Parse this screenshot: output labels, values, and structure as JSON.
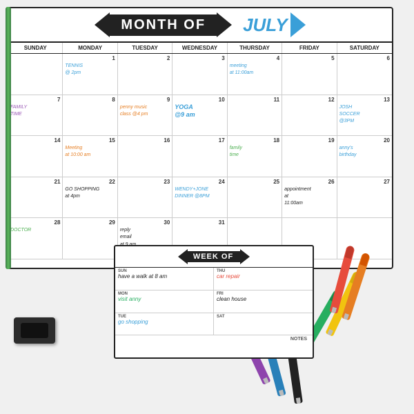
{
  "header": {
    "month_of_label": "MONTH OF",
    "month_name": "JULY"
  },
  "day_headers": [
    "SUNDAY",
    "MONDAY",
    "TUESDAY",
    "WEDNESDAY",
    "THURSDAY",
    "FRIDAY",
    "SATURDAY"
  ],
  "calendar": {
    "weeks": [
      [
        {
          "num": "",
          "events": []
        },
        {
          "num": "1",
          "events": [
            {
              "text": "TENNIS @ 2pm",
              "color": "blue"
            }
          ]
        },
        {
          "num": "2",
          "events": []
        },
        {
          "num": "3",
          "events": []
        },
        {
          "num": "4",
          "events": [
            {
              "text": "meeting at 11:00am",
              "color": "blue"
            }
          ]
        },
        {
          "num": "5",
          "events": []
        },
        {
          "num": "6",
          "events": []
        }
      ],
      [
        {
          "num": "7",
          "events": [
            {
              "text": "FAMILY TIME",
              "color": "purple"
            }
          ]
        },
        {
          "num": "8",
          "events": []
        },
        {
          "num": "9",
          "events": [
            {
              "text": "penny music class @4 pm",
              "color": "orange"
            }
          ]
        },
        {
          "num": "10",
          "events": [
            {
              "text": "YOGA @9 am",
              "color": "blue"
            }
          ]
        },
        {
          "num": "11",
          "events": []
        },
        {
          "num": "12",
          "events": []
        },
        {
          "num": "13",
          "events": [
            {
              "text": "JOSH SOCCER @3PM",
              "color": "blue"
            }
          ]
        }
      ],
      [
        {
          "num": "14",
          "events": []
        },
        {
          "num": "15",
          "events": [
            {
              "text": "Meeting at 10:00 am",
              "color": "orange"
            }
          ]
        },
        {
          "num": "16",
          "events": []
        },
        {
          "num": "17",
          "events": []
        },
        {
          "num": "18",
          "events": [
            {
              "text": "family time",
              "color": "green"
            }
          ]
        },
        {
          "num": "19",
          "events": []
        },
        {
          "num": "20",
          "events": [
            {
              "text": "anny's birthday",
              "color": "blue"
            }
          ]
        }
      ],
      [
        {
          "num": "21",
          "events": []
        },
        {
          "num": "22",
          "events": [
            {
              "text": "GO SHOPPING at 4pm",
              "color": "dark"
            }
          ]
        },
        {
          "num": "23",
          "events": []
        },
        {
          "num": "24",
          "events": [
            {
              "text": "WENDY+JONE DINNER @8PM",
              "color": "blue"
            }
          ]
        },
        {
          "num": "25",
          "events": []
        },
        {
          "num": "26",
          "events": [
            {
              "text": "appointment at 11:00am",
              "color": "dark"
            }
          ]
        },
        {
          "num": "27",
          "events": []
        }
      ],
      [
        {
          "num": "28",
          "events": [
            {
              "text": "DOCTOR",
              "color": "green"
            }
          ]
        },
        {
          "num": "29",
          "events": []
        },
        {
          "num": "30",
          "events": [
            {
              "text": "reply email at 9 am",
              "color": "dark"
            }
          ]
        },
        {
          "num": "31",
          "events": []
        },
        {
          "num": "",
          "events": []
        },
        {
          "num": "",
          "events": []
        },
        {
          "num": "",
          "events": []
        }
      ]
    ]
  },
  "week_planner": {
    "title": "WEEK OF",
    "cells": [
      {
        "day": "SUN",
        "event": "have a walk at 8 am",
        "color": "dark",
        "position": "left"
      },
      {
        "day": "THU",
        "event": "car repair",
        "color": "red",
        "position": "right"
      },
      {
        "day": "MON",
        "event": "visit anny",
        "color": "green",
        "position": "left"
      },
      {
        "day": "FRI",
        "event": "clean house",
        "color": "dark",
        "position": "right"
      },
      {
        "day": "TUE",
        "event": "go shopping",
        "color": "blue",
        "position": "left"
      },
      {
        "day": "SAT",
        "event": "",
        "color": "dark",
        "position": "right"
      },
      {
        "day": "NOTES",
        "event": "",
        "color": "dark",
        "position": "full"
      }
    ]
  },
  "eraser": {
    "label": "eraser"
  },
  "markers": {
    "colors": [
      "red",
      "orange",
      "yellow",
      "green",
      "purple",
      "blue",
      "black"
    ]
  }
}
